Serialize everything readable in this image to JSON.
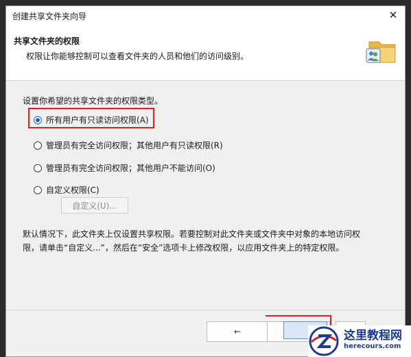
{
  "window": {
    "title": "创建共享文件夹向导",
    "close_symbol": "✕"
  },
  "header": {
    "title": "共享文件夹的权限",
    "subtitle": "权限让你能够控制可以查看文件夹的人员和他们的访问级别。",
    "icon": "shared-folder-users-icon"
  },
  "main": {
    "prompt": "设置你希望的共享文件夹的权限类型。",
    "options": [
      {
        "label": "所有用户有只读访问权限(A)",
        "checked": true
      },
      {
        "label": "管理员有完全访问权限；其他用户有只读权限(R)",
        "checked": false
      },
      {
        "label": "管理员有完全访问权限；其他用户不能访问(O)",
        "checked": false
      },
      {
        "label": "自定义权限(C)",
        "checked": false
      }
    ],
    "custom_button": "自定义(U)...",
    "note": "默认情况下，此文件夹上仅设置共享权限。若要控制对此文件夹或文件夹中对象的本地访问权限，请单击“自定义...”，然后在“安全”选项卡上修改权限，以应用文件夹上的特定权限。"
  },
  "footer": {
    "back_arrow": "←"
  },
  "watermark": {
    "title": "这里教程网",
    "url": "herecours.com"
  },
  "colors": {
    "highlight": "#e02020",
    "accent": "#1a66c2",
    "watermark": "#1e3a8a"
  }
}
